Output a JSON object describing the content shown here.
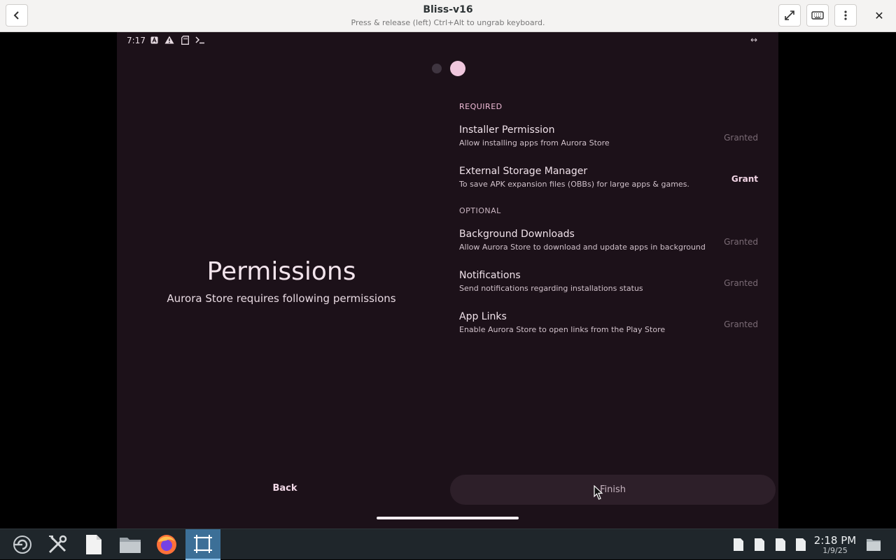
{
  "window": {
    "title": "Bliss-v16",
    "subtitle": "Press & release (left) Ctrl+Alt to ungrab keyboard.",
    "back_icon": "chevron-left-icon",
    "fullscreen_icon": "expand-icon",
    "keyboard_icon": "keyboard-icon",
    "menu_icon": "kebab-menu-icon",
    "close_label": "✕"
  },
  "status_bar": {
    "time": "7:17",
    "icons": [
      "a-badge-icon",
      "warning-icon",
      "sd-card-icon",
      "terminal-icon"
    ],
    "right_label": "↔"
  },
  "page_indicator": {
    "total": 2,
    "active": 2
  },
  "intro": {
    "title": "Permissions",
    "subtitle": "Aurora Store requires following permissions"
  },
  "sections": {
    "required_label": "REQUIRED",
    "optional_label": "OPTIONAL"
  },
  "permissions": {
    "installer": {
      "title": "Installer Permission",
      "desc": "Allow installing apps from Aurora Store",
      "status": "Granted"
    },
    "storage": {
      "title": "External Storage Manager",
      "desc": "To save APK expansion files (OBBs) for large apps & games.",
      "status": "Grant"
    },
    "background": {
      "title": "Background Downloads",
      "desc": "Allow Aurora Store to download and update apps in background",
      "status": "Granted"
    },
    "notifications": {
      "title": "Notifications",
      "desc": "Send notifications regarding installations status",
      "status": "Granted"
    },
    "applinks": {
      "title": "App Links",
      "desc": "Enable Aurora Store to open links from the Play Store",
      "status": "Granted"
    }
  },
  "buttons": {
    "back": "Back",
    "finish": "Finish"
  },
  "taskbar": {
    "apps": [
      "app-launcher-icon",
      "system-settings-icon",
      "text-editor-icon",
      "file-manager-icon",
      "firefox-icon",
      "waydroid-icon"
    ],
    "clock_time": "2:18 PM",
    "clock_date": "1/9/25",
    "tray": [
      "clipboard-icon",
      "document-icon",
      "document-icon",
      "document-icon",
      "folder-icon"
    ]
  },
  "colors": {
    "screen_bg": "#1c1119",
    "accent_pink": "#efc7dd",
    "taskbar_bg": "#1f262b",
    "titlebar_bg": "#f4f3f2"
  }
}
